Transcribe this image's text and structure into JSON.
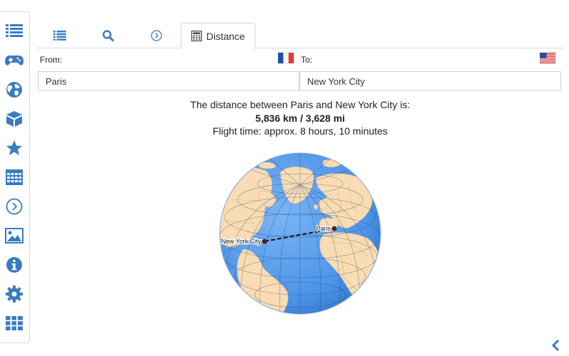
{
  "colors": {
    "accent": "#3a7bbf",
    "ocean": "#4d94e8",
    "land": "#f9dcb3",
    "route": "#111111"
  },
  "sidebar": {
    "items": [
      {
        "icon": "list-icon"
      },
      {
        "icon": "gamepad-icon"
      },
      {
        "icon": "globe-icon"
      },
      {
        "icon": "cube-icon"
      },
      {
        "icon": "star-icon"
      },
      {
        "icon": "calendar-icon"
      },
      {
        "icon": "chevron-circle-icon"
      },
      {
        "icon": "image-icon"
      },
      {
        "icon": "info-icon"
      },
      {
        "icon": "gear-icon"
      },
      {
        "icon": "grid-icon"
      }
    ]
  },
  "tabs": {
    "items": [
      {
        "icon": "list-icon",
        "label": ""
      },
      {
        "icon": "search-icon",
        "label": ""
      },
      {
        "icon": "chevron-circle-icon",
        "label": ""
      },
      {
        "icon": "calculator-icon",
        "label": "Distance"
      }
    ],
    "active_index": 3
  },
  "form": {
    "from_label": "From:",
    "to_label": "To:",
    "from_value": "Paris",
    "to_value": "New York City",
    "from_flag": "flag-france",
    "to_flag": "flag-usa"
  },
  "result": {
    "line1": "The distance between Paris and New York City is:",
    "line2": "5,836 km / 3,628 mi",
    "line3": "Flight time: approx. 8 hours, 10 minutes"
  },
  "map": {
    "origin_label": "Paris",
    "destination_label": "New York City"
  },
  "footer": {
    "back_icon": "chevron-left-icon"
  }
}
